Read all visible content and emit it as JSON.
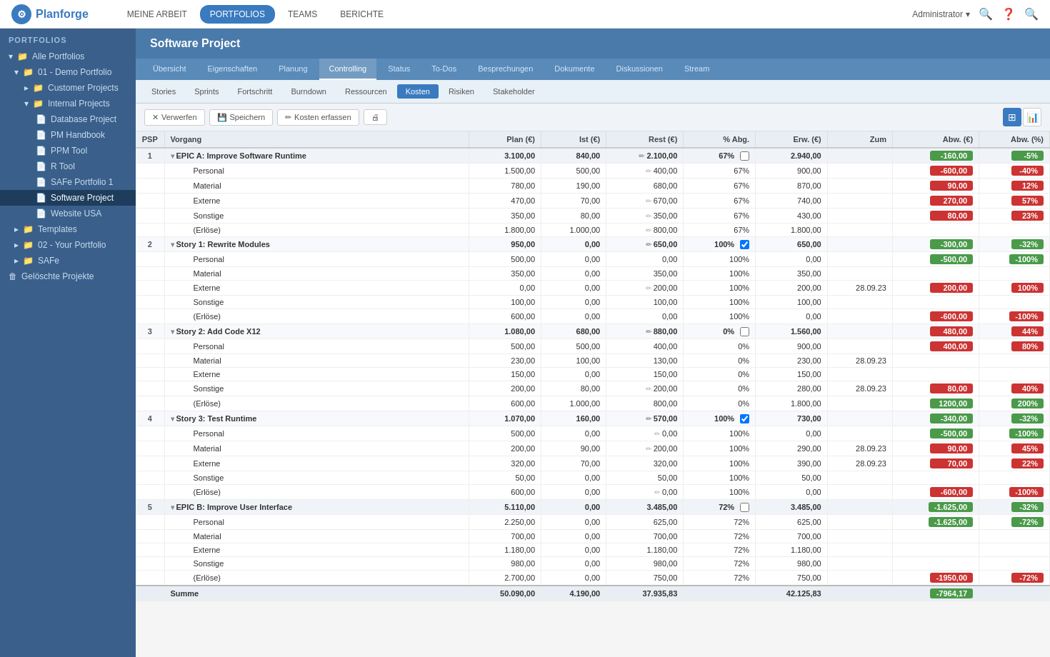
{
  "topNav": {
    "logo": "Planforge",
    "navItems": [
      {
        "label": "MEINE ARBEIT",
        "active": false
      },
      {
        "label": "PORTFOLIOS",
        "active": true
      },
      {
        "label": "TEAMS",
        "active": false
      },
      {
        "label": "BERICHTE",
        "active": false
      }
    ],
    "user": "Administrator"
  },
  "sidebar": {
    "title": "PORTFOLIOS",
    "items": [
      {
        "label": "Alle Portfolios",
        "level": 0,
        "type": "root",
        "expanded": true
      },
      {
        "label": "01 - Demo Portfolio",
        "level": 1,
        "type": "folder",
        "expanded": true
      },
      {
        "label": "Customer Projects",
        "level": 2,
        "type": "folder",
        "expanded": false
      },
      {
        "label": "Internal Projects",
        "level": 2,
        "type": "folder",
        "expanded": true
      },
      {
        "label": "Database Project",
        "level": 3,
        "type": "page"
      },
      {
        "label": "PM Handbook",
        "level": 3,
        "type": "page"
      },
      {
        "label": "PPM Tool",
        "level": 3,
        "type": "page"
      },
      {
        "label": "R Tool",
        "level": 3,
        "type": "page"
      },
      {
        "label": "SAFe Portfolio 1",
        "level": 3,
        "type": "page"
      },
      {
        "label": "Software Project",
        "level": 3,
        "type": "page",
        "active": true
      },
      {
        "label": "Website USA",
        "level": 3,
        "type": "page"
      },
      {
        "label": "Templates",
        "level": 1,
        "type": "folder",
        "expanded": false
      },
      {
        "label": "02 - Your Portfolio",
        "level": 1,
        "type": "folder",
        "expanded": false
      },
      {
        "label": "SAFe",
        "level": 1,
        "type": "folder",
        "expanded": false
      },
      {
        "label": "Gelöschte Projekte",
        "level": 0,
        "type": "trash"
      }
    ]
  },
  "page": {
    "title": "Software Project",
    "tabs": [
      {
        "label": "Übersicht"
      },
      {
        "label": "Eigenschaften"
      },
      {
        "label": "Planung"
      },
      {
        "label": "Controlling",
        "active": true
      },
      {
        "label": "Status"
      },
      {
        "label": "To-Dos"
      },
      {
        "label": "Besprechungen"
      },
      {
        "label": "Dokumente"
      },
      {
        "label": "Diskussionen"
      },
      {
        "label": "Stream"
      }
    ],
    "subTabs": [
      {
        "label": "Stories"
      },
      {
        "label": "Sprints"
      },
      {
        "label": "Fortschritt"
      },
      {
        "label": "Burndown"
      },
      {
        "label": "Ressourcen"
      },
      {
        "label": "Kosten",
        "active": true
      },
      {
        "label": "Risiken"
      },
      {
        "label": "Stakeholder"
      }
    ],
    "toolbar": {
      "verwerfen": "Verwerfen",
      "speichern": "Speichern",
      "kosten_erfassen": "Kosten erfassen"
    }
  },
  "table": {
    "columns": [
      "PSP",
      "Vorgang",
      "Plan (€)",
      "Ist (€)",
      "Rest (€)",
      "% Abg.",
      "Erw. (€)",
      "Zum",
      "Abw. (€)",
      "Abw. (%)"
    ],
    "rows": [
      {
        "num": "1",
        "type": "epic",
        "label": "EPIC A: Improve Software Runtime",
        "plan": "3.100,00",
        "ist": "840,00",
        "rest": "2.100,00",
        "rest_pencil": true,
        "pct": "67%",
        "checkbox": false,
        "erw": "2.940,00",
        "zum": "",
        "abw": "-160,00",
        "abw_color": "green",
        "abw_pct": "-5%",
        "abw_pct_color": "green",
        "children": [
          {
            "label": "Personal",
            "plan": "1.500,00",
            "ist": "500,00",
            "rest": "400,00",
            "rest_pencil": true,
            "pct": "67%",
            "erw": "900,00",
            "zum": "",
            "abw": "-600,00",
            "abw_color": "red",
            "abw_pct": "-40%",
            "abw_pct_color": "red"
          },
          {
            "label": "Material",
            "plan": "780,00",
            "ist": "190,00",
            "rest": "680,00",
            "rest_pencil": false,
            "pct": "67%",
            "erw": "870,00",
            "zum": "",
            "abw": "90,00",
            "abw_color": "red",
            "abw_pct": "12%",
            "abw_pct_color": "red"
          },
          {
            "label": "Externe",
            "plan": "470,00",
            "ist": "70,00",
            "rest": "670,00",
            "rest_pencil": true,
            "pct": "67%",
            "erw": "740,00",
            "zum": "",
            "abw": "270,00",
            "abw_color": "red",
            "abw_pct": "57%",
            "abw_pct_color": "red"
          },
          {
            "label": "Sonstige",
            "plan": "350,00",
            "ist": "80,00",
            "rest": "350,00",
            "rest_pencil": true,
            "pct": "67%",
            "erw": "430,00",
            "zum": "",
            "abw": "80,00",
            "abw_color": "red",
            "abw_pct": "23%",
            "abw_pct_color": "red"
          },
          {
            "label": "(Erlöse)",
            "plan": "1.800,00",
            "ist": "1.000,00",
            "rest": "800,00",
            "rest_pencil": true,
            "pct": "67%",
            "erw": "1.800,00",
            "zum": "",
            "abw": "",
            "abw_color": "",
            "abw_pct": "",
            "abw_pct_color": ""
          }
        ]
      },
      {
        "num": "2",
        "type": "story",
        "label": "Story 1: Rewrite Modules",
        "plan": "950,00",
        "ist": "0,00",
        "rest": "650,00",
        "rest_pencil": true,
        "pct": "100%",
        "checkbox": true,
        "erw": "650,00",
        "zum": "",
        "abw": "-300,00",
        "abw_color": "green",
        "abw_pct": "-32%",
        "abw_pct_color": "green",
        "children": [
          {
            "label": "Personal",
            "plan": "500,00",
            "ist": "0,00",
            "rest": "0,00",
            "rest_pencil": false,
            "pct": "100%",
            "erw": "0,00",
            "zum": "",
            "abw": "-500,00",
            "abw_color": "green",
            "abw_pct": "-100%",
            "abw_pct_color": "green"
          },
          {
            "label": "Material",
            "plan": "350,00",
            "ist": "0,00",
            "rest": "350,00",
            "rest_pencil": false,
            "pct": "100%",
            "erw": "350,00",
            "zum": "",
            "abw": "",
            "abw_color": "",
            "abw_pct": "",
            "abw_pct_color": ""
          },
          {
            "label": "Externe",
            "plan": "0,00",
            "ist": "0,00",
            "rest": "200,00",
            "rest_pencil": true,
            "pct": "100%",
            "erw": "200,00",
            "zum": "28.09.23",
            "abw": "200,00",
            "abw_color": "red",
            "abw_pct": "100%",
            "abw_pct_color": "red"
          },
          {
            "label": "Sonstige",
            "plan": "100,00",
            "ist": "0,00",
            "rest": "100,00",
            "rest_pencil": false,
            "pct": "100%",
            "erw": "100,00",
            "zum": "",
            "abw": "",
            "abw_color": "",
            "abw_pct": "",
            "abw_pct_color": ""
          },
          {
            "label": "(Erlöse)",
            "plan": "600,00",
            "ist": "0,00",
            "rest": "0,00",
            "rest_pencil": false,
            "pct": "100%",
            "erw": "0,00",
            "zum": "",
            "abw": "-600,00",
            "abw_color": "red",
            "abw_pct": "-100%",
            "abw_pct_color": "red"
          }
        ]
      },
      {
        "num": "3",
        "type": "story",
        "label": "Story 2: Add Code X12",
        "plan": "1.080,00",
        "ist": "680,00",
        "rest": "880,00",
        "rest_pencil": true,
        "pct": "0%",
        "checkbox": false,
        "erw": "1.560,00",
        "zum": "",
        "abw": "480,00",
        "abw_color": "red",
        "abw_pct": "44%",
        "abw_pct_color": "red",
        "children": [
          {
            "label": "Personal",
            "plan": "500,00",
            "ist": "500,00",
            "rest": "400,00",
            "rest_pencil": false,
            "pct": "0%",
            "erw": "900,00",
            "zum": "",
            "abw": "400,00",
            "abw_color": "red",
            "abw_pct": "80%",
            "abw_pct_color": "red"
          },
          {
            "label": "Material",
            "plan": "230,00",
            "ist": "100,00",
            "rest": "130,00",
            "rest_pencil": false,
            "pct": "0%",
            "erw": "230,00",
            "zum": "28.09.23",
            "abw": "",
            "abw_color": "",
            "abw_pct": "",
            "abw_pct_color": ""
          },
          {
            "label": "Externe",
            "plan": "150,00",
            "ist": "0,00",
            "rest": "150,00",
            "rest_pencil": false,
            "pct": "0%",
            "erw": "150,00",
            "zum": "",
            "abw": "",
            "abw_color": "",
            "abw_pct": "",
            "abw_pct_color": ""
          },
          {
            "label": "Sonstige",
            "plan": "200,00",
            "ist": "80,00",
            "rest": "200,00",
            "rest_pencil": true,
            "pct": "0%",
            "erw": "280,00",
            "zum": "28.09.23",
            "abw": "80,00",
            "abw_color": "red",
            "abw_pct": "40%",
            "abw_pct_color": "red"
          },
          {
            "label": "(Erlöse)",
            "plan": "600,00",
            "ist": "1.000,00",
            "rest": "800,00",
            "rest_pencil": false,
            "pct": "0%",
            "erw": "1.800,00",
            "zum": "",
            "abw": "1200,00",
            "abw_color": "green",
            "abw_pct": "200%",
            "abw_pct_color": "green"
          }
        ]
      },
      {
        "num": "4",
        "type": "story",
        "label": "Story 3: Test Runtime",
        "plan": "1.070,00",
        "ist": "160,00",
        "rest": "570,00",
        "rest_pencil": true,
        "pct": "100%",
        "checkbox": true,
        "erw": "730,00",
        "zum": "",
        "abw": "-340,00",
        "abw_color": "green",
        "abw_pct": "-32%",
        "abw_pct_color": "green",
        "children": [
          {
            "label": "Personal",
            "plan": "500,00",
            "ist": "0,00",
            "rest": "0,00",
            "rest_pencil": true,
            "pct": "100%",
            "erw": "0,00",
            "zum": "",
            "abw": "-500,00",
            "abw_color": "green",
            "abw_pct": "-100%",
            "abw_pct_color": "green"
          },
          {
            "label": "Material",
            "plan": "200,00",
            "ist": "90,00",
            "rest": "200,00",
            "rest_pencil": true,
            "pct": "100%",
            "erw": "290,00",
            "zum": "28.09.23",
            "abw": "90,00",
            "abw_color": "red",
            "abw_pct": "45%",
            "abw_pct_color": "red"
          },
          {
            "label": "Externe",
            "plan": "320,00",
            "ist": "70,00",
            "rest": "320,00",
            "rest_pencil": false,
            "pct": "100%",
            "erw": "390,00",
            "zum": "28.09.23",
            "abw": "70,00",
            "abw_color": "red",
            "abw_pct": "22%",
            "abw_pct_color": "red"
          },
          {
            "label": "Sonstige",
            "plan": "50,00",
            "ist": "0,00",
            "rest": "50,00",
            "rest_pencil": false,
            "pct": "100%",
            "erw": "50,00",
            "zum": "",
            "abw": "",
            "abw_color": "",
            "abw_pct": "",
            "abw_pct_color": ""
          },
          {
            "label": "(Erlöse)",
            "plan": "600,00",
            "ist": "0,00",
            "rest": "0,00",
            "rest_pencil": true,
            "pct": "100%",
            "erw": "0,00",
            "zum": "",
            "abw": "-600,00",
            "abw_color": "red",
            "abw_pct": "-100%",
            "abw_pct_color": "red"
          }
        ]
      },
      {
        "num": "5",
        "type": "epic",
        "label": "EPIC B: Improve User Interface",
        "plan": "5.110,00",
        "ist": "0,00",
        "rest": "3.485,00",
        "rest_pencil": false,
        "pct": "72%",
        "checkbox": false,
        "erw": "3.485,00",
        "zum": "",
        "abw": "-1.625,00",
        "abw_color": "green",
        "abw_pct": "-32%",
        "abw_pct_color": "green",
        "children": [
          {
            "label": "Personal",
            "plan": "2.250,00",
            "ist": "0,00",
            "rest": "625,00",
            "rest_pencil": false,
            "pct": "72%",
            "erw": "625,00",
            "zum": "",
            "abw": "-1.625,00",
            "abw_color": "green",
            "abw_pct": "-72%",
            "abw_pct_color": "green"
          },
          {
            "label": "Material",
            "plan": "700,00",
            "ist": "0,00",
            "rest": "700,00",
            "rest_pencil": false,
            "pct": "72%",
            "erw": "700,00",
            "zum": "",
            "abw": "",
            "abw_color": "",
            "abw_pct": "",
            "abw_pct_color": ""
          },
          {
            "label": "Externe",
            "plan": "1.180,00",
            "ist": "0,00",
            "rest": "1.180,00",
            "rest_pencil": false,
            "pct": "72%",
            "erw": "1.180,00",
            "zum": "",
            "abw": "",
            "abw_color": "",
            "abw_pct": "",
            "abw_pct_color": ""
          },
          {
            "label": "Sonstige",
            "plan": "980,00",
            "ist": "0,00",
            "rest": "980,00",
            "rest_pencil": false,
            "pct": "72%",
            "erw": "980,00",
            "zum": "",
            "abw": "",
            "abw_color": "",
            "abw_pct": "",
            "abw_pct_color": ""
          },
          {
            "label": "(Erlöse)",
            "plan": "2.700,00",
            "ist": "0,00",
            "rest": "750,00",
            "rest_pencil": false,
            "pct": "72%",
            "erw": "750,00",
            "zum": "",
            "abw": "-1950,00",
            "abw_color": "red",
            "abw_pct": "-72%",
            "abw_pct_color": "red"
          }
        ]
      }
    ],
    "total": {
      "label": "Summe",
      "plan": "50.090,00",
      "ist": "4.190,00",
      "rest": "37.935,83",
      "erw": "42.125,83",
      "abw": "-7964,17",
      "abw_color": "green",
      "abw_pct": ""
    }
  }
}
